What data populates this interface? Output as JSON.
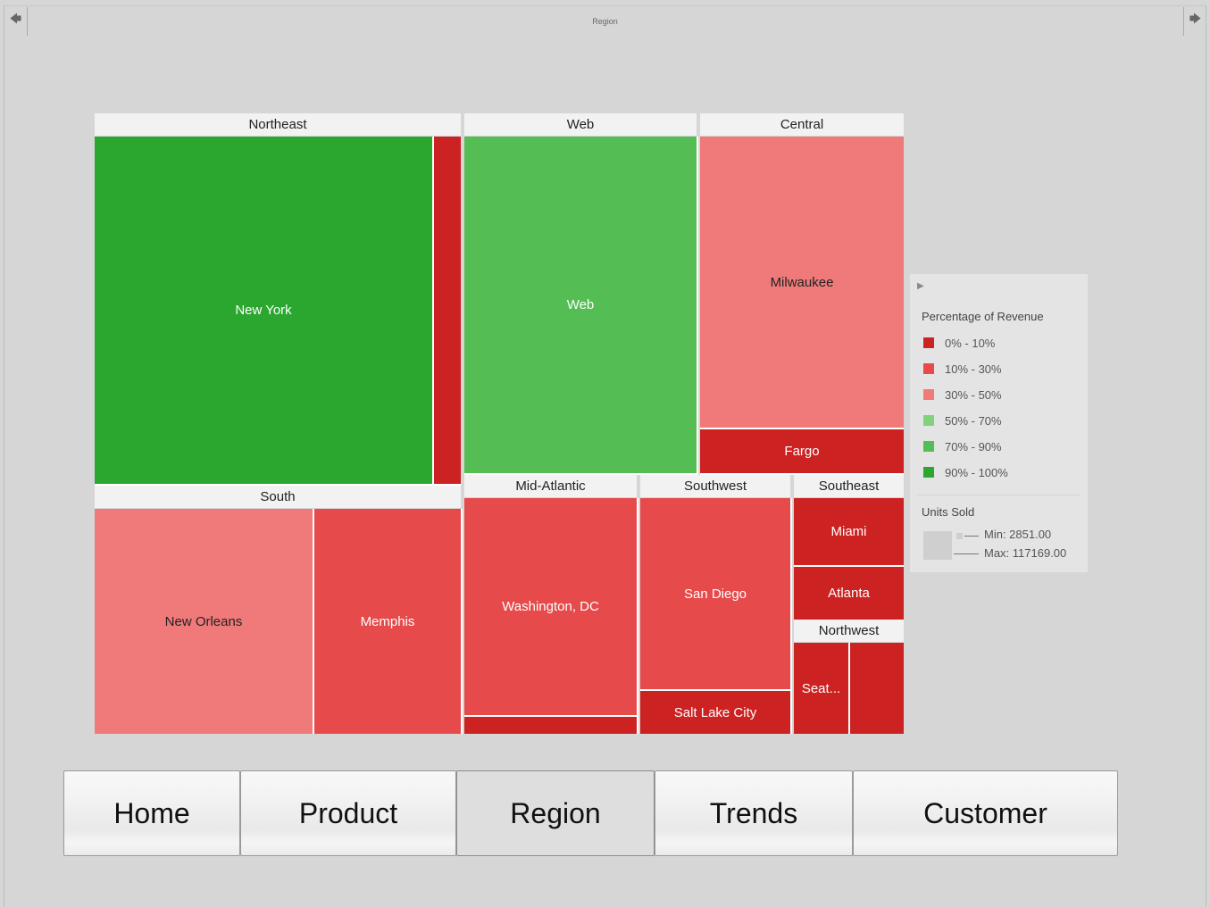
{
  "nav": {
    "back_icon": "left-arrow-icon",
    "forward_icon": "right-arrow-icon",
    "back_glyph": "🡄",
    "forward_glyph": "🡆"
  },
  "page": {
    "title": "Region"
  },
  "treemap": {
    "groups": {
      "northeast": "Northeast",
      "web": "Web",
      "central": "Central",
      "south": "South",
      "midatlantic": "Mid-Atlantic",
      "southwest": "Southwest",
      "southeast": "Southeast",
      "northwest": "Northwest"
    },
    "cells": {
      "new_york": "New York",
      "web": "Web",
      "milwaukee": "Milwaukee",
      "fargo": "Fargo",
      "new_orleans": "New Orleans",
      "memphis": "Memphis",
      "washington": "Washington, DC",
      "san_diego": "San Diego",
      "salt_lake": "Salt Lake City",
      "miami": "Miami",
      "atlanta": "Atlanta",
      "seattle": "Seat..."
    },
    "colors": {
      "c0_10": "#cc2222",
      "c10_30": "#e64a4a",
      "c30_50": "#f07a7a",
      "c50_70": "#7fd37f",
      "c70_90": "#54bd54",
      "c90_100": "#2ba62f"
    }
  },
  "legend": {
    "toggle_icon": "expand-triangle-icon",
    "toggle_glyph": "▶",
    "title": "Percentage of Revenue",
    "items": [
      {
        "label": "0% - 10%",
        "color": "#cc2222"
      },
      {
        "label": "10% - 30%",
        "color": "#e64a4a"
      },
      {
        "label": "30% - 50%",
        "color": "#f07a7a"
      },
      {
        "label": "50% - 70%",
        "color": "#7fd37f"
      },
      {
        "label": "70% - 90%",
        "color": "#54bd54"
      },
      {
        "label": "90% - 100%",
        "color": "#2ba62f"
      }
    ],
    "units_title": "Units Sold",
    "min": "Min: 2851.00",
    "max": "Max: 117169.00"
  },
  "tabs": [
    {
      "label": "Home"
    },
    {
      "label": "Product"
    },
    {
      "label": "Region",
      "active": true
    },
    {
      "label": "Trends"
    },
    {
      "label": "Customer"
    }
  ]
}
